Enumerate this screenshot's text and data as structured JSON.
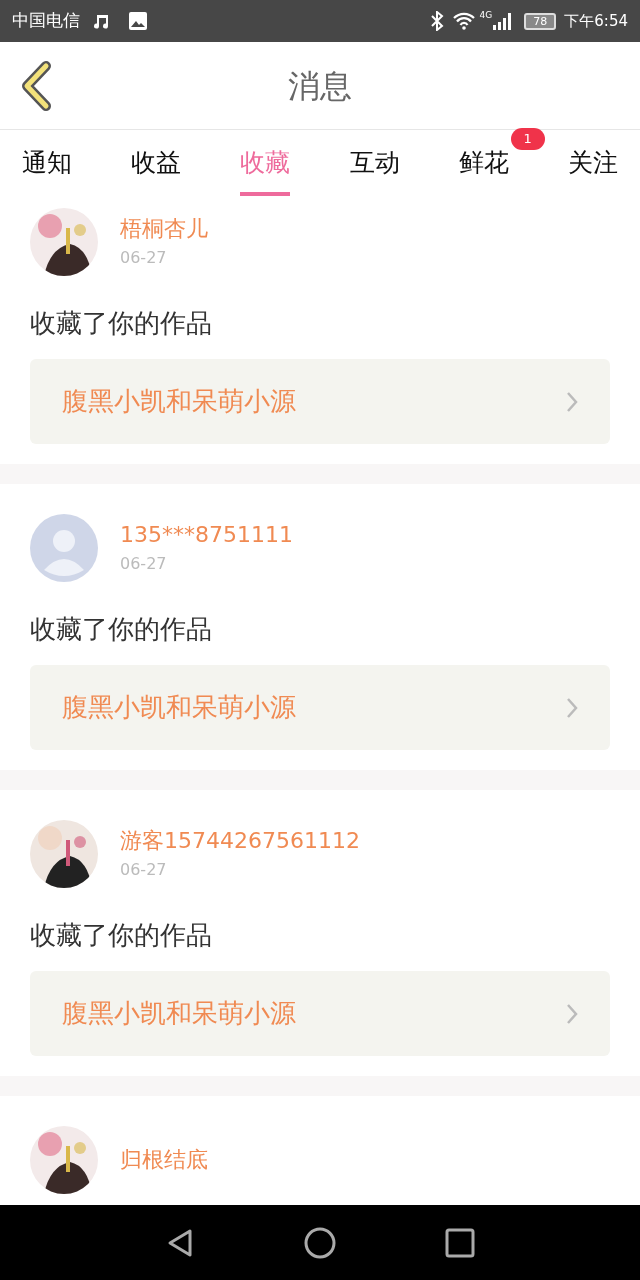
{
  "status_bar": {
    "carrier": "中国电信",
    "network": "4G",
    "battery": "78",
    "time": "下午6:54"
  },
  "header": {
    "title": "消息"
  },
  "tabs": [
    {
      "label": "通知",
      "selected": false
    },
    {
      "label": "收益",
      "selected": false
    },
    {
      "label": "收藏",
      "selected": true
    },
    {
      "label": "互动",
      "selected": false
    },
    {
      "label": "鲜花",
      "selected": false,
      "badge": "1"
    },
    {
      "label": "关注",
      "selected": false
    }
  ],
  "messages": [
    {
      "name": "梧桐杏儿",
      "date": "06-27",
      "text": "收藏了你的作品",
      "work": "腹黑小凯和呆萌小源"
    },
    {
      "name": "135***8751111",
      "avatar": {
        "kind": "silhouette"
      },
      "date": "06-27",
      "text": "收藏了你的作品",
      "work": "腹黑小凯和呆萌小源"
    },
    {
      "name": "游客15744267561112",
      "date": "06-27",
      "text": "收藏了你的作品",
      "work": "腹黑小凯和呆萌小源"
    },
    {
      "name": "归根结底"
    }
  ]
}
